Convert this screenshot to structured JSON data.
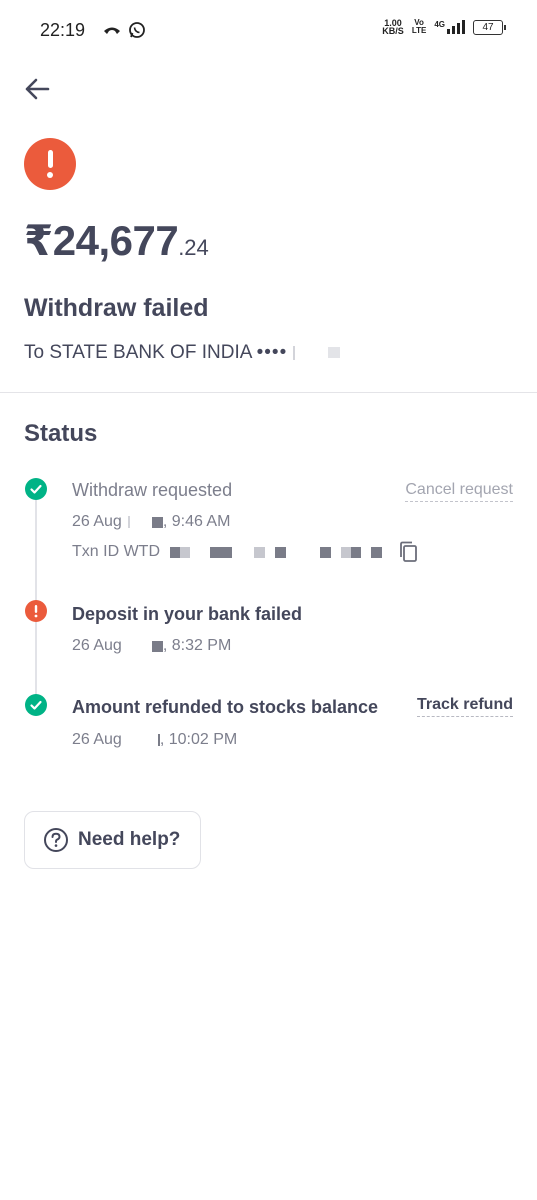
{
  "status_bar": {
    "time": "22:19",
    "network_speed_value": "1.00",
    "network_speed_unit": "KB/S",
    "volte_top": "Vo",
    "volte_bottom": "LTE",
    "network_type": "4G",
    "battery": "47"
  },
  "transaction": {
    "amount_main": "₹24,677",
    "amount_paise": ".24",
    "title": "Withdraw failed",
    "bank_prefix": "To STATE BANK OF INDIA",
    "bank_mask": "••••"
  },
  "status": {
    "section_title": "Status",
    "steps": [
      {
        "title": "Withdraw requested",
        "date": "26 Aug",
        "time": ", 9:46 AM",
        "txn_prefix": "Txn ID WTD",
        "action": "Cancel request",
        "state": "success"
      },
      {
        "title": "Deposit in your bank failed",
        "date": "26 Aug",
        "time": ", 8:32 PM",
        "state": "failed"
      },
      {
        "title": "Amount refunded to stocks balance",
        "date": "26 Aug",
        "time": ", 10:02 PM",
        "action": "Track refund",
        "state": "success"
      }
    ]
  },
  "help": {
    "label": "Need help?"
  },
  "colors": {
    "success": "#00b386",
    "failed": "#eb5b3c",
    "text": "#44475b",
    "muted": "#7c7e8c"
  }
}
